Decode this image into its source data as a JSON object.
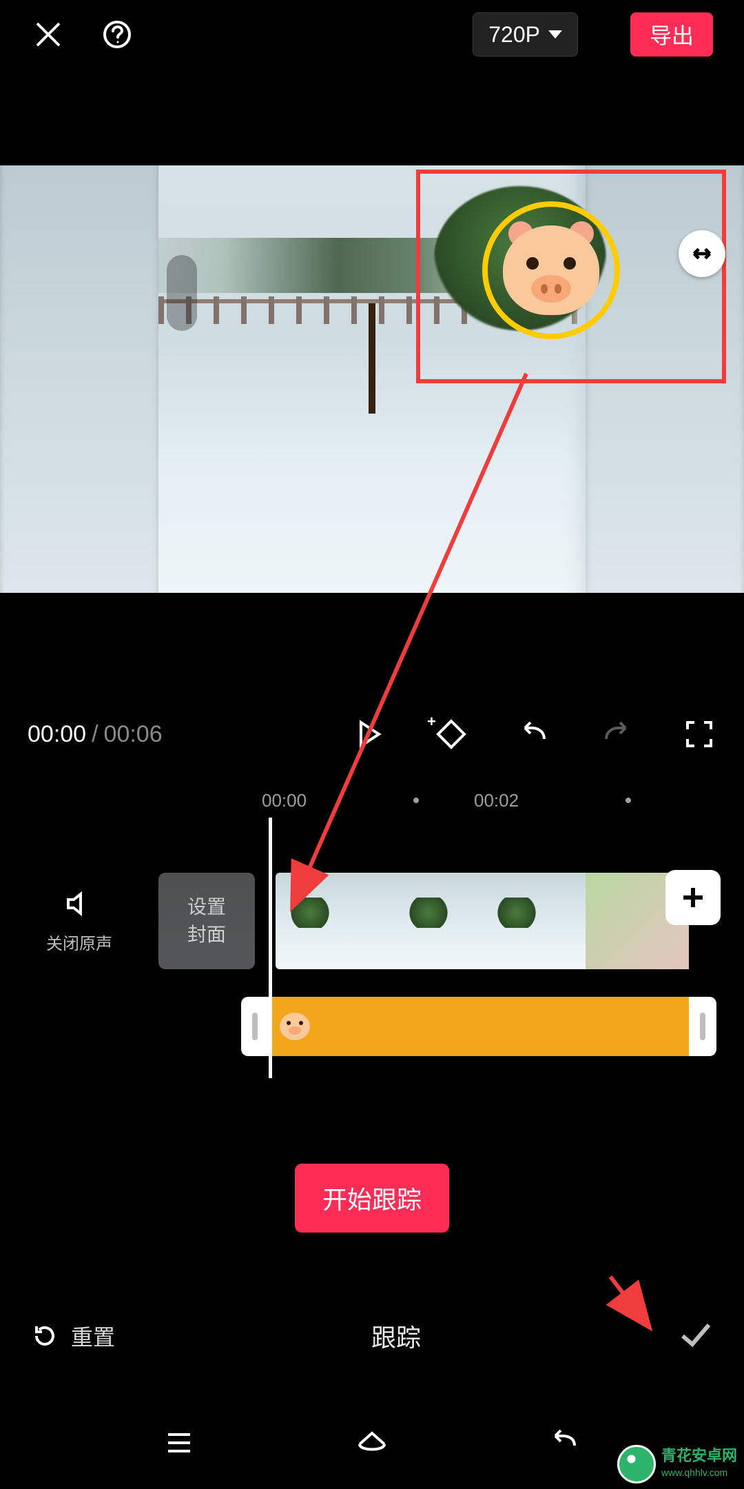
{
  "top": {
    "resolution": "720P",
    "export_label": "导出"
  },
  "playback": {
    "current": "00:00",
    "total": "00:06"
  },
  "ruler": {
    "ticks": [
      "00:00",
      "00:02"
    ]
  },
  "mute": {
    "label": "关闭原声"
  },
  "cover": {
    "line1": "设置",
    "line2": "封面"
  },
  "action": {
    "start_tracking": "开始跟踪"
  },
  "panel": {
    "reset": "重置",
    "title": "跟踪"
  },
  "watermark": {
    "name": "青花安卓网",
    "url": "www.qhhlv.com"
  },
  "colors": {
    "accent": "#ff2d55",
    "tracker_ring": "#ffcc00",
    "annotation": "#ef3d3d",
    "sticker_track": "#f2a71b"
  }
}
